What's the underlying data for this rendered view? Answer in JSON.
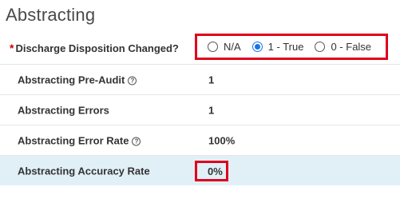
{
  "section": {
    "title": "Abstracting"
  },
  "fields": {
    "discharge": {
      "required_mark": "*",
      "label": "Discharge Disposition Changed?",
      "options": [
        {
          "label": "N/A",
          "selected": false
        },
        {
          "label": "1 - True",
          "selected": true
        },
        {
          "label": "0 - False",
          "selected": false
        }
      ]
    },
    "pre_audit": {
      "label": "Abstracting Pre-Audit",
      "value": "1",
      "help_icon": "question-circle-icon"
    },
    "errors": {
      "label": "Abstracting Errors",
      "value": "1"
    },
    "error_rate": {
      "label": "Abstracting Error Rate",
      "value": "100%",
      "help_icon": "question-circle-icon"
    },
    "accuracy_rate": {
      "label": "Abstracting Accuracy Rate",
      "value": "0%"
    }
  },
  "colors": {
    "highlight_row": "#e1f0f7",
    "annotation_border": "#e0001b",
    "radio_selected": "#1a73e8",
    "required_mark": "#cc0000"
  }
}
